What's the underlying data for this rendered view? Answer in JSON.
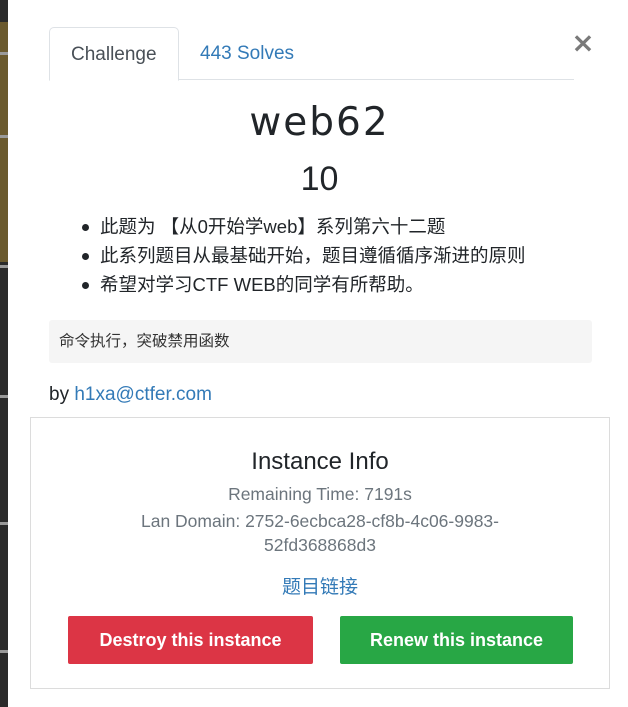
{
  "tabs": [
    {
      "label": "Challenge",
      "active": true
    },
    {
      "label": "443 Solves",
      "active": false
    }
  ],
  "close_label": "×",
  "challenge": {
    "name": "web62",
    "points": "10",
    "description_items": [
      "此题为 【从0开始学web】系列第六十二题",
      "此系列题目从最基础开始，题目遵循循序渐进的原则",
      "希望对学习CTF WEB的同学有所帮助。"
    ],
    "hint": "命令执行，突破禁用函数",
    "author_prefix": "by",
    "author_email": "h1xa@ctfer.com"
  },
  "instance": {
    "title": "Instance Info",
    "remaining_time": "Remaining Time: 7191s",
    "lan_domain_line1": "Lan Domain: 2752-6ecbca28-cf8b-4c06-9983-",
    "lan_domain_line2": "52fd368868d3",
    "link_label": "题目链接",
    "destroy_label": "Destroy this instance",
    "renew_label": "Renew this instance"
  },
  "colors": {
    "link": "#337ab7",
    "destroy": "#dc3545",
    "renew": "#28a745"
  }
}
